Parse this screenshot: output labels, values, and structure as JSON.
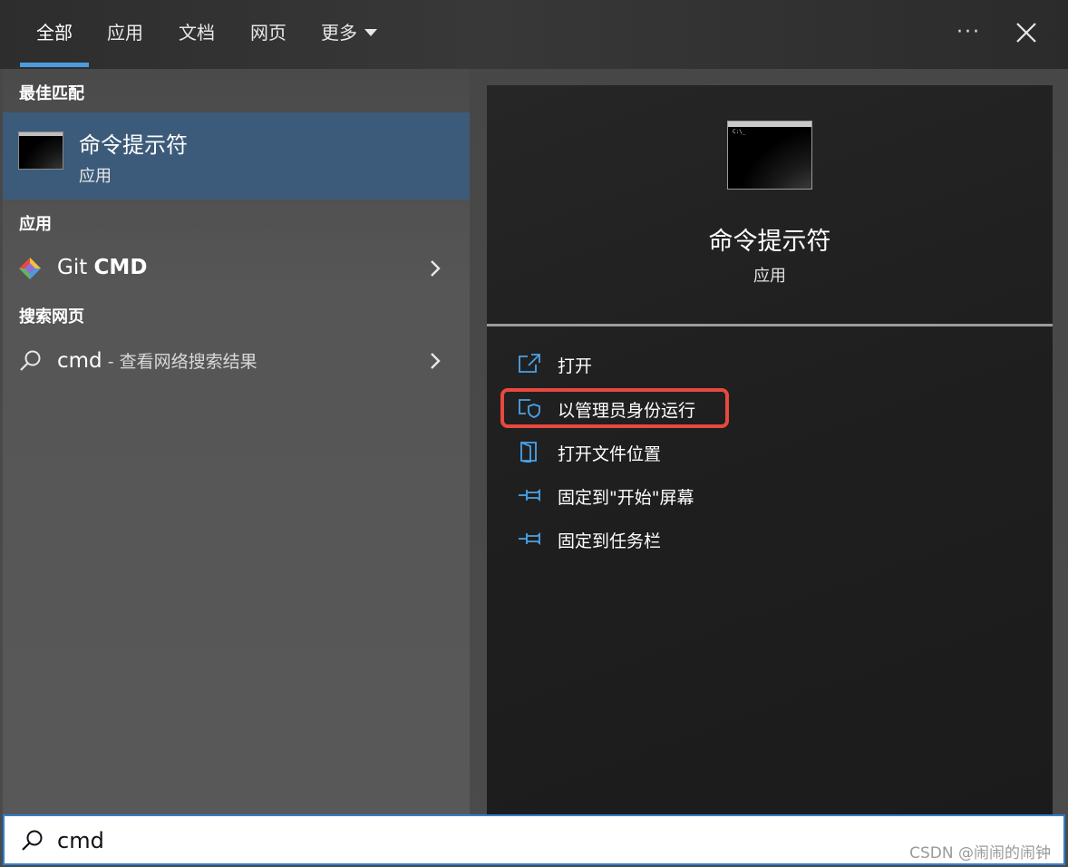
{
  "tabs": [
    {
      "label": "全部",
      "active": true
    },
    {
      "label": "应用"
    },
    {
      "label": "文档"
    },
    {
      "label": "网页"
    },
    {
      "label": "更多"
    }
  ],
  "left": {
    "best_match_heading": "最佳匹配",
    "best_match": {
      "title": "命令提示符",
      "subtitle": "应用"
    },
    "apps_heading": "应用",
    "app_item": {
      "name_prefix": "Git ",
      "name_bold": "CMD"
    },
    "web_heading": "搜索网页",
    "web_item": {
      "query": "cmd",
      "suffix": " - 查看网络搜索结果"
    }
  },
  "preview": {
    "title": "命令提示符",
    "subtitle": "应用",
    "icon_prompt": "C:\\_",
    "actions": [
      {
        "label": "打开",
        "icon": "open-external-icon"
      },
      {
        "label": "以管理员身份运行",
        "icon": "admin-shield-icon",
        "highlighted": true
      },
      {
        "label": "打开文件位置",
        "icon": "file-location-icon"
      },
      {
        "label": "固定到\"开始\"屏幕",
        "icon": "pin-icon"
      },
      {
        "label": "固定到任务栏",
        "icon": "pin-icon"
      }
    ]
  },
  "search": {
    "value": "cmd"
  },
  "watermark": "CSDN @闹闹的闹钟",
  "colors": {
    "accent": "#4c9bdf",
    "selected": "#3c5b7a",
    "highlight_border": "#e8483f"
  }
}
